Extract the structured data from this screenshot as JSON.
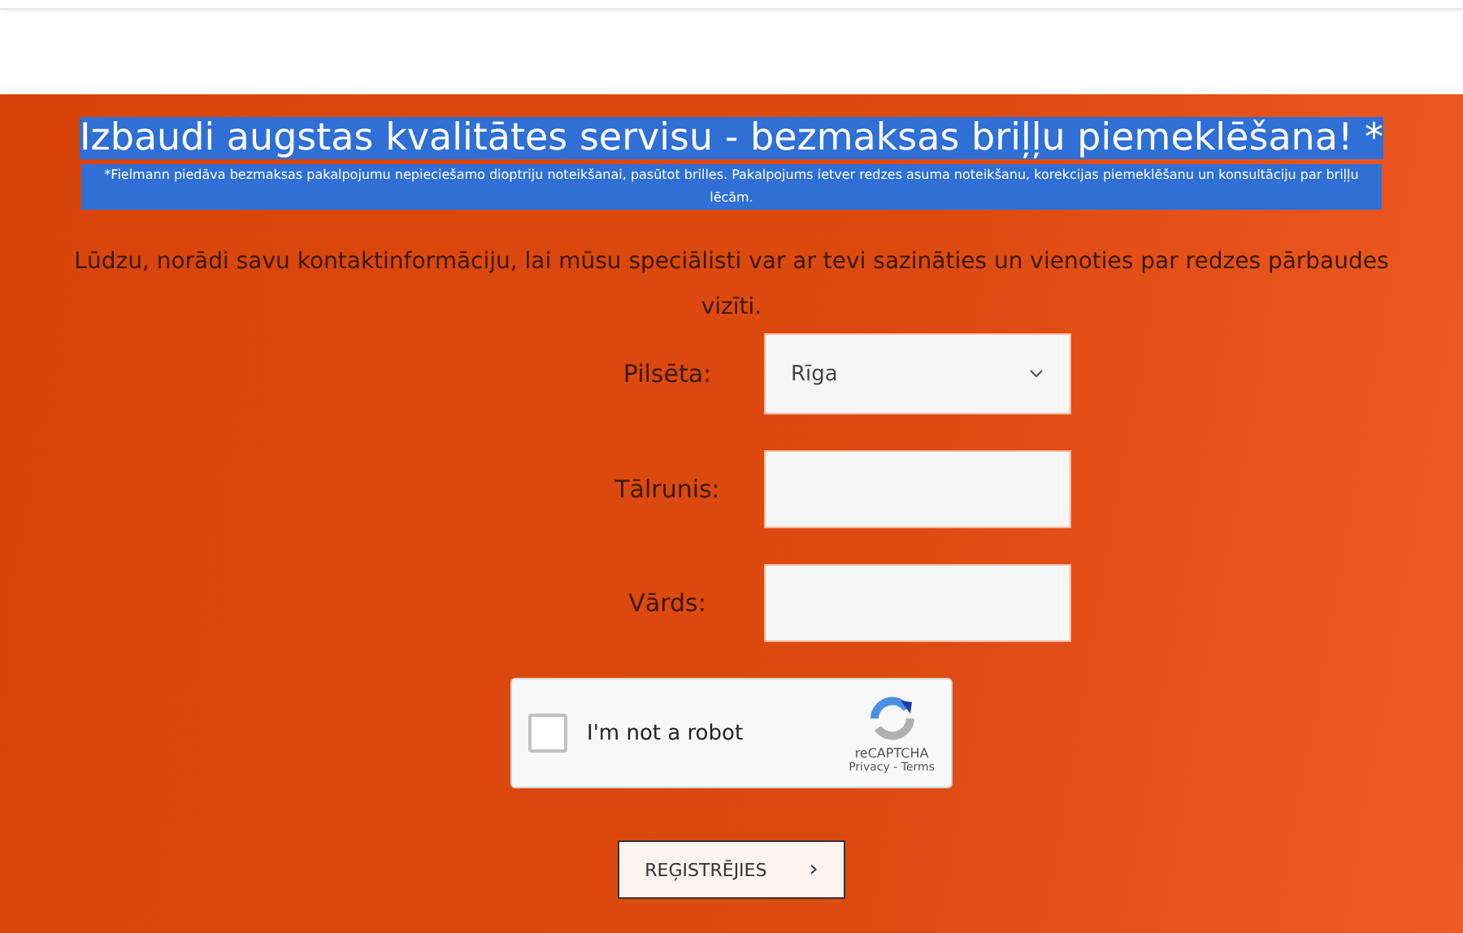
{
  "heading": {
    "text": "Izbaudi augstas kvalitātes servisu - bezmaksas briļļu piemeklēšana! *",
    "highlighted": true
  },
  "note": {
    "text": "*Fielmann piedāva bezmaksas pakalpojumu nepieciešamo dioptriju noteikšanai, pasūtot brilles. Pakalpojums ietver redzes asuma noteikšanu, korekcijas piemeklēšanu un konsultāciju par briļļu lēcām.",
    "highlighted": true
  },
  "intro": "Lūdzu, norādi savu kontaktinformāciju, lai mūsu speciālisti var ar tevi sazināties un vienoties par redzes pārbaudes vizīti.",
  "fields": [
    {
      "kind": "select",
      "label": "Pilsēta:",
      "value": "Rīga"
    },
    {
      "kind": "text",
      "label": "Tālrunis:"
    },
    {
      "kind": "text",
      "label": "Vārds:"
    }
  ],
  "captcha": {
    "label": "I'm not a robot",
    "checked": false,
    "brand": "reCAPTCHA",
    "links": "Privacy - Terms"
  },
  "submit": {
    "label": "REĢISTRĒJIES",
    "arrow": "›"
  }
}
